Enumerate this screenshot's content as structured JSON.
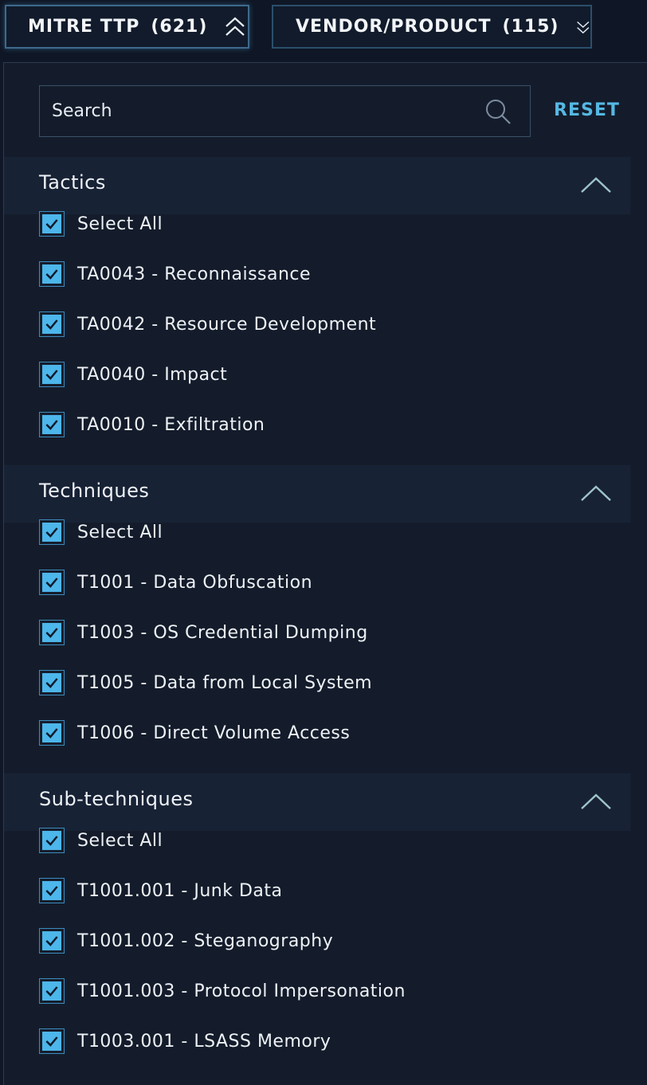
{
  "filters": [
    {
      "label": "MITRE TTP",
      "count": "(621)",
      "state": "expanded"
    },
    {
      "label": "VENDOR/PRODUCT",
      "count": "(115)",
      "state": "collapsed"
    }
  ],
  "search": {
    "placeholder": "Search",
    "value": ""
  },
  "reset_label": "RESET",
  "sections": [
    {
      "title": "Tactics",
      "items": [
        {
          "label": "Select All",
          "checked": true
        },
        {
          "label": "TA0043 - Reconnaissance",
          "checked": true
        },
        {
          "label": "TA0042 - Resource Development",
          "checked": true
        },
        {
          "label": "TA0040 - Impact",
          "checked": true
        },
        {
          "label": "TA0010 - Exfiltration",
          "checked": true
        }
      ]
    },
    {
      "title": "Techniques",
      "items": [
        {
          "label": "Select All",
          "checked": true
        },
        {
          "label": "T1001 - Data Obfuscation",
          "checked": true
        },
        {
          "label": "T1003 - OS Credential Dumping",
          "checked": true
        },
        {
          "label": "T1005 - Data from Local System",
          "checked": true
        },
        {
          "label": "T1006 - Direct Volume Access",
          "checked": true
        }
      ]
    },
    {
      "title": "Sub-techniques",
      "items": [
        {
          "label": "Select All",
          "checked": true
        },
        {
          "label": "T1001.001 - Junk Data",
          "checked": true
        },
        {
          "label": "T1001.002 - Steganography",
          "checked": true
        },
        {
          "label": "T1001.003 - Protocol Impersonation",
          "checked": true
        },
        {
          "label": "T1003.001 - LSASS Memory",
          "checked": true
        }
      ]
    }
  ],
  "colors": {
    "accent": "#4db6ea",
    "reset": "#55b8e3",
    "background": "#141c2b",
    "section_header": "#182235"
  },
  "icons": {
    "filter_expanded": "double-chevron-up-icon",
    "filter_collapsed": "double-chevron-down-icon",
    "search": "search-icon",
    "section_collapse": "chevron-up-icon",
    "checkbox": "checkmark-icon"
  }
}
